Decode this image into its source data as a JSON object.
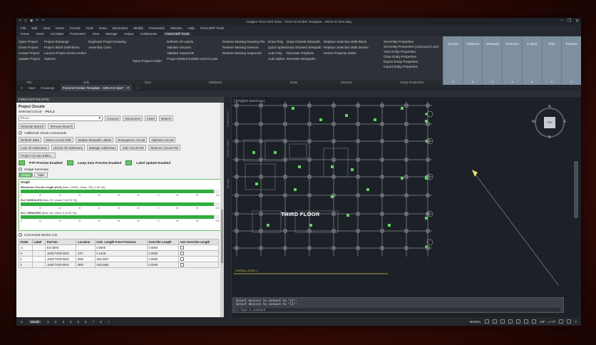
{
  "window": {
    "title": "Cadgen FireCAD® 2024 · FireCAD Ember Template - ARCH D Size.dwg",
    "quick_icons": [
      "≡",
      "▢",
      "▣",
      "↶",
      "↷"
    ],
    "controls": [
      "–",
      "❐",
      "✕"
    ]
  },
  "menubar": [
    "File",
    "Edit",
    "View",
    "Insert",
    "Format",
    "Tools",
    "Draw",
    "Dimension",
    "Modify",
    "Parametric",
    "Window",
    "Help",
    "FireCAD® Tools"
  ],
  "ribbon_tabs": [
    "Home",
    "Insert",
    "Annotate",
    "Parametric",
    "View",
    "Manage",
    "Output",
    "Collaborate",
    "FireCAD® Tools"
  ],
  "ribbon_active_tab": "FireCAD® Tools",
  "ribbon": {
    "col1": [
      "Open Project",
      "Close Project",
      "Create Project",
      "Update Project"
    ],
    "col2": [
      "Project Drawings",
      "Project Block Definitions",
      "Launch Project Device Editor",
      "Options"
    ],
    "col3": [
      "Duplicate Project Drawing",
      "Assembly Color"
    ],
    "col4": [
      "Open Project Folder"
    ],
    "col5": [
      "Refresh All Labels",
      "Validate Devices",
      "Validate Segments",
      "Purge Deleted Entities and Circuits"
    ],
    "col6": [
      "Restore Missing Drawing File",
      "Restore Missing Devices",
      "Restore Missing Segments"
    ],
    "col7": [
      "Draw Poly",
      "Quick Spline",
      "Auto Poly",
      "Auto Spline"
    ],
    "col8": [
      "Draw Closest Wirepath",
      "Draw Shortest Wirepath",
      "Recreate Polylines",
      "Recreate Wirepaths"
    ],
    "col9": [
      "Replace Selection With Block",
      "Replace Selection With Device",
      "Device Property Editor"
    ],
    "col10": [
      "Set Entity Properties",
      "Set Entity Properties (Command Line)",
      "View Entity Properties",
      "Clear Entity Properties",
      "Export Entity Properties",
      "Import Entity Properties"
    ],
    "group_labels": [
      "File",
      "Edit",
      "View",
      "Validation",
      "Draw",
      "Devices",
      "Entity Properties"
    ],
    "right_panels": [
      "Circuits",
      "Attributes",
      "Wirepath",
      "Selection",
      "Coding",
      "Risk",
      "Reports"
    ]
  },
  "doc_tabs": [
    "Start",
    "Drawing1",
    "FireCAD Ember Template - ARCH D Size*",
    "+"
  ],
  "doc_tab_close": "✕",
  "palette": {
    "header": "FIRECAD® PALETTE",
    "section_title": "Project Circuits",
    "selected_circuit_label": "Selected Circuit -",
    "selected_circuit_value": "P1-L1",
    "circuit_select": "P1-L1",
    "connect": "Connect",
    "disconnect": "Disconnect",
    "insert": "Insert",
    "branch": "Branch",
    "relocate_branch": "Relocate Branch",
    "remove_branch": "Remove Branch",
    "additional_commands": "Additional Circuit Commands",
    "cmd_row1": [
      "Refresh Data",
      "Select Circuit Path",
      "Update Wirepath Labels",
      "Resequence Circuit",
      "Optimize Circuit"
    ],
    "cmd_row2": [
      "Lock All Addresses",
      "Unlock All Addresses",
      "Manage Addresses",
      "Add Circuit Pair",
      "Remove Circuit Pair"
    ],
    "cmd_row3": [
      "Project Circuits Editor..."
    ],
    "toggle1": "PTP Preview Enabled",
    "toggle2": "Lump Sum Preview Enabled",
    "toggle3": "Label Update Enabled",
    "usage_summary": "Usage Summary",
    "tab_graph": "Graph",
    "tab_table": "Table",
    "graph_title": "Graph",
    "graph_items": [
      {
        "label": "Maximum Circuit Length (feet)",
        "detail": "[Max: 10000, Used: 752 (7.52 %)]",
        "fill": 0.97
      },
      {
        "label": "SLC MODULES",
        "detail": "[Max: 99, Used: 0 (0.00 %)]",
        "fill": 0.97
      },
      {
        "label": "SLC SENSORS",
        "detail": "[Max: 99, Used: 0 (0.00 %)]",
        "fill": 0.97
      }
    ],
    "graph_ticks": [
      "0",
      "10",
      "20",
      "30",
      "40",
      "50",
      "60",
      "70",
      "80",
      "90",
      "100"
    ],
    "connected_device_list": "Connected Device List",
    "table_headers": [
      "Order",
      "Label",
      "Part No",
      "Location",
      "Calc. Length From Previous",
      "Override Length",
      "Use Override Length"
    ],
    "table_rows": [
      [
        "-1",
        "",
        "ES-200X",
        "",
        "0.0000",
        "0.0000",
        ""
      ],
      [
        "0",
        "",
        "JUNCTION BOX",
        "1ST",
        "3.1408",
        "0.0000",
        ""
      ],
      [
        "1",
        "",
        "JUNCTION BOX",
        "2ND",
        "162.8037",
        "0.0000",
        ""
      ],
      [
        "2",
        "",
        "JUNCTION BOX",
        "3RD",
        "163.6484",
        "0.0000",
        ""
      ]
    ]
  },
  "canvas": {
    "view_label": "[-][Top][2D Wireframe]",
    "floor_label": "THIRD FLOOR",
    "ruler_labels": [
      "Project Tree",
      "Device Editor",
      "Circuits"
    ],
    "viewcube_top": "TOP",
    "dir_n": "N",
    "dir_s": "S",
    "dir_e": "E",
    "dir_w": "W",
    "bottom_text": "OVERALL LEVEL 1",
    "cmd_lines": [
      "Select devices to connect to \"L1\":",
      "Select devices to connect to \"L1\":"
    ],
    "cmd_placeholder": "Type a command"
  },
  "statusbar": {
    "tabs": [
      "Model",
      "1",
      "2",
      "3",
      "4",
      "5",
      "6",
      "7",
      "8",
      "+"
    ],
    "model_label": "MODEL",
    "scale": "1/8\" = 1'-0\"",
    "hamburger": "≡"
  },
  "colors": {
    "accent_green": "#2eae3d",
    "device_green": "#5fd35f",
    "grid_line": "#b8bcc4",
    "ribbon_right_panel": "#7e8fa0",
    "background_red": "#6a1a0e"
  }
}
